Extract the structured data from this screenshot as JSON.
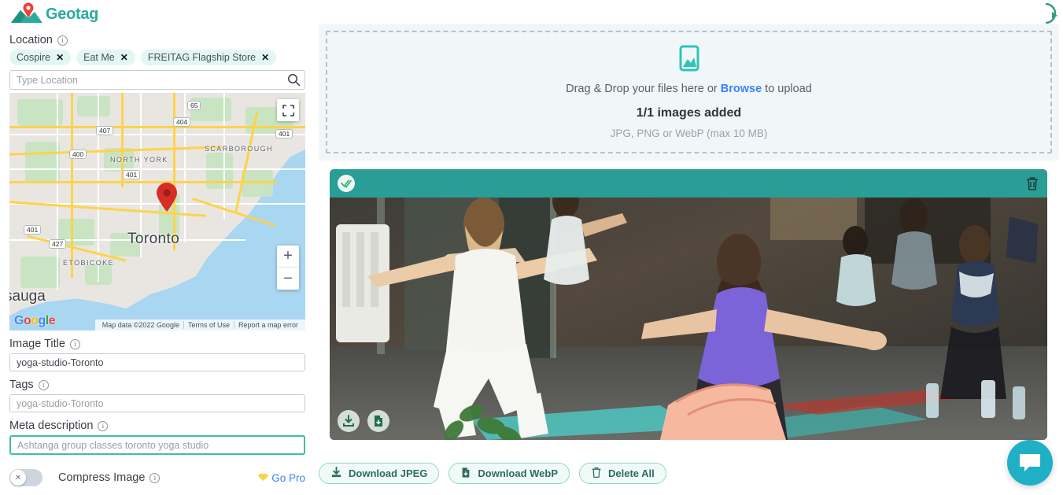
{
  "brand": {
    "name": "Geotag",
    "color": "#2aab9f"
  },
  "left": {
    "location": {
      "label": "Location",
      "chips": [
        {
          "label": "Cospire",
          "close": "✕"
        },
        {
          "label": "Eat Me",
          "close": "✕"
        },
        {
          "label": "FREITAG Flagship Store",
          "close": "✕"
        }
      ],
      "input_placeholder": "Type Location",
      "input_value": "",
      "search_icon": "search-icon"
    },
    "map": {
      "center_label": "Toronto",
      "places": [
        "SCARBOROUGH",
        "NORTH YORK",
        "ETOBICOKE",
        "sauga"
      ],
      "highway_shields": [
        "65",
        "404",
        "407",
        "400",
        "401",
        "401",
        "401",
        "427"
      ],
      "attribution": [
        "Map data ©2022 Google",
        "Terms of Use",
        "Report a map error"
      ],
      "google_logo": "Google",
      "zoom_in": "+",
      "zoom_out": "−",
      "fullscreen_icon": "fullscreen-icon",
      "pin_icon": "map-pin-icon"
    },
    "image_title": {
      "label": "Image Title",
      "value": "yoga-studio-Toronto",
      "placeholder": ""
    },
    "tags": {
      "label": "Tags",
      "value": "",
      "placeholder": "yoga-studio-Toronto"
    },
    "meta_description": {
      "label": "Meta description",
      "value": "",
      "placeholder": "Ashtanga group classes toronto yoga studio",
      "focused": true
    },
    "compress": {
      "label": "Compress Image",
      "toggle_state": "off",
      "toggle_glyph": "✕",
      "go_pro": "Go Pro",
      "go_pro_icon": "diamond-icon"
    }
  },
  "right": {
    "dropzone": {
      "icon": "image-placeholder-icon",
      "line_prefix": "Drag & Drop your files here or ",
      "browse": "Browse",
      "line_suffix": " to upload",
      "count": "1/1 images added",
      "formats": "JPG, PNG or WebP (max 10 MB)"
    },
    "image_card": {
      "check_icon": "double-check-icon",
      "delete_icon": "trash-icon",
      "download_icon": "download-tray-icon",
      "save_file_icon": "file-download-icon",
      "photo_alt": "yoga class group stretching in studio",
      "header_color": "#2a9d96"
    },
    "actions": [
      {
        "label": "Download JPEG",
        "icon": "download-icon"
      },
      {
        "label": "Download WebP",
        "icon": "file-download-icon"
      },
      {
        "label": "Delete All",
        "icon": "trash-icon"
      }
    ],
    "chat": {
      "icon": "chat-bubble-icon",
      "color": "#20b0c6"
    }
  }
}
